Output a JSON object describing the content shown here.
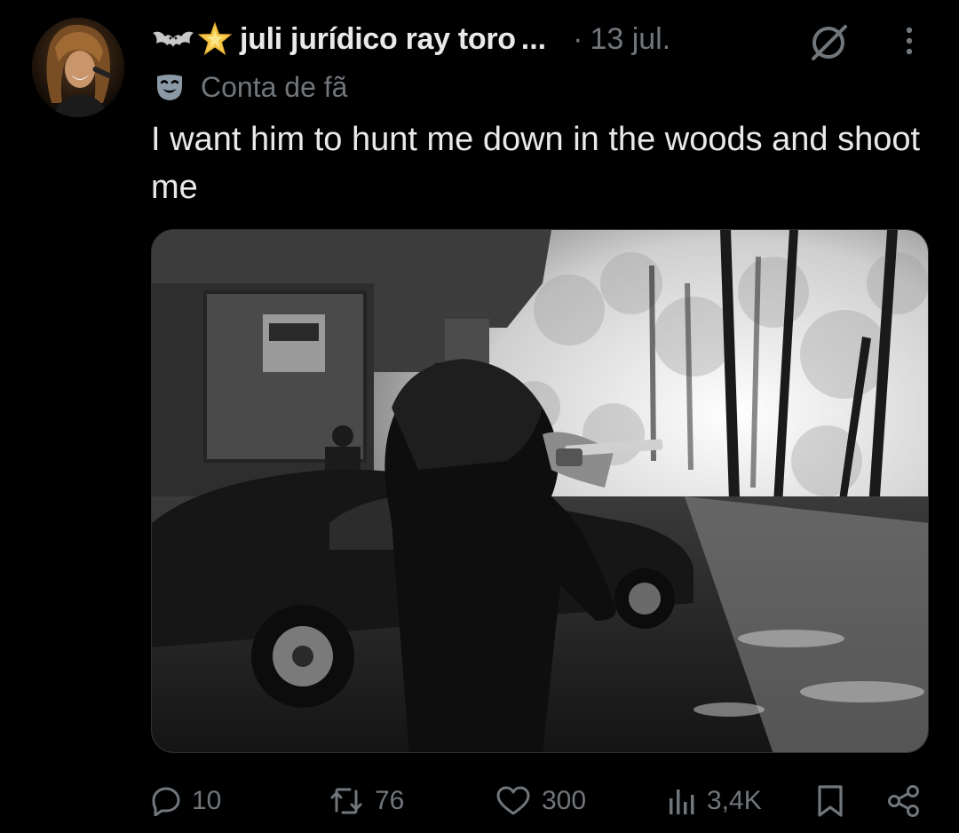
{
  "post": {
    "author": {
      "display_name": "juli jurídico ray toro",
      "truncation": "...",
      "emoji_1": "bat-emoji",
      "emoji_2": "glowing-star-emoji"
    },
    "separator": "·",
    "date": "13 jul.",
    "account_badge": {
      "icon": "performing-arts-mask-icon",
      "label": "Conta de fã"
    },
    "text": "I want him to hunt me down in the woods and shoot me",
    "media": {
      "type": "photo",
      "style": "black-and-white"
    },
    "actions": {
      "reply_count": "10",
      "repost_count": "76",
      "like_count": "300",
      "views_count": "3,4K"
    }
  },
  "colors": {
    "background": "#000000",
    "primary_text": "#e7e9ea",
    "secondary_text": "#71767b",
    "star_yellow": "#f7c948",
    "mask_color": "#8b98a5"
  },
  "icons": {
    "grok": "grok-icon",
    "more": "more-vertical-icon",
    "reply": "reply-icon",
    "repost": "repost-icon",
    "like": "heart-icon",
    "views": "views-bar-chart-icon",
    "bookmark": "bookmark-icon",
    "share": "share-icon"
  }
}
